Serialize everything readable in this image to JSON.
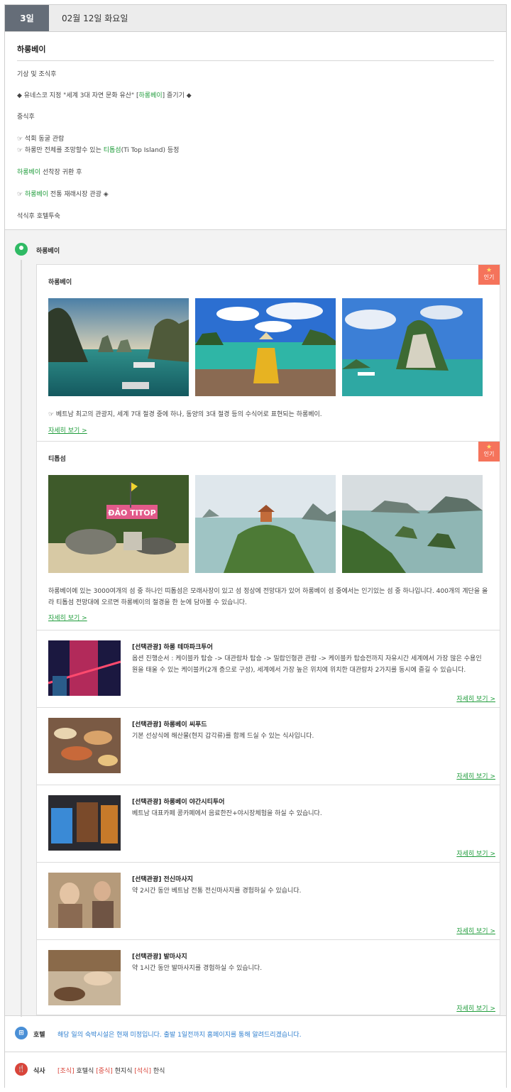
{
  "day": {
    "number": "3일",
    "date": "02월 12일 화요일"
  },
  "summary": {
    "title": "하롱베이",
    "lines": [
      {
        "parts": [
          "기상 및 조식후"
        ]
      },
      {
        "parts": [
          "◆ 유네스코 지정 \"세계 3대 자연 문화 유산\" [",
          "하롱베이",
          "] 즐기기 ◆"
        ]
      },
      {
        "parts": [
          "중식후"
        ]
      },
      {
        "parts": [
          "☞ 석회 동굴 관람"
        ]
      },
      {
        "parts": [
          "☞ 하롱만 전체를 조망할수 있는 ",
          "티톱섬",
          "(Ti Top Island) 등정"
        ]
      },
      {
        "parts": [
          "",
          "하롱베이",
          " 선착장 귀환 후"
        ]
      },
      {
        "parts": [
          "☞ ",
          "하롱베이",
          " 전통 재래시장 관광 ◈"
        ]
      },
      {
        "parts": [
          "석식후 호텔투숙"
        ]
      }
    ]
  },
  "location": {
    "label": "하롱베이"
  },
  "spots": [
    {
      "title": "하롱베이",
      "badge": "인기",
      "desc": "☞ 베트남 최고의 관광지, 세계 7대 절경 중에 하나, 동양의 3대 절경 등의 수식어로 표현되는 하롱베이.",
      "more": "자세히 보기 >"
    },
    {
      "title": "티톱섬",
      "badge": "인기",
      "desc": "하롱베이에 있는 3000여개의 섬 중 하나인 띠톱섬은 모래사장이 있고 섬 정상에 전망대가 있어 하롱베이 섬 중에서는 인기있는 섬 중 하나입니다. 400개의 계단을 올라 티톱섬 전망대에 오르면 하롱베이의 절경을 한 눈에 담아볼 수 있습니다.",
      "more": "자세히 보기 >",
      "sign": "ĐẢO TITOP"
    }
  ],
  "options": [
    {
      "title": "[선택관광] 하롱 테마파크투어",
      "desc": "옵션 진행순서 : 케이블카 탑승 -> 대관람차 탑승 -> 밀랍인형관 관람 -> 케이블카 탑승전까지 자유시간 세계에서 가장 많은 수용인원을 태울 수 있는 케이블카(2개 층으로 구성), 세계에서 가장 높은 위치에 위치한 대관람차 2가지를 동시에 즐길 수 있습니다.",
      "more": "자세히 보기 >"
    },
    {
      "title": "[선택관광] 하롱베이 씨푸드",
      "desc": "기본 선상식에 해산물(현지 갑각류)를 함께 드실 수 있는 식사입니다.",
      "more": "자세히 보기 >"
    },
    {
      "title": "[선택관광] 하롱베이 야간시티투어",
      "desc": "베트남 대표카페 콩카페에서 음료한잔+야시장체험을 하실 수 있습니다.",
      "more": "자세히 보기 >"
    },
    {
      "title": "[선택관광] 전신마사지",
      "desc": "약 2시간 동안 베트남 전통 전신마사지를 경험하실 수 있습니다.",
      "more": "자세히 보기 >"
    },
    {
      "title": "[선택관광] 발마사지",
      "desc": "약 1시간 동안 발마사지를 경험하실 수 있습니다.",
      "more": "자세히 보기 >"
    }
  ],
  "hotel": {
    "label": "호텔",
    "icon": "hotel-icon",
    "text": "해당 일의 숙박시설은 현재 미정입니다. 출발 1일전까지 홈페이지를 통해 알려드리겠습니다."
  },
  "meal": {
    "label": "식사",
    "icon": "fork-knife-icon",
    "breakfast_tag": "[조식]",
    "breakfast": "호텔식",
    "lunch_tag": "[중식]",
    "lunch": "현지식",
    "dinner_tag": "[석식]",
    "dinner": "한식"
  },
  "colors": {
    "day_badge": "#656d78",
    "accent_green": "#1f9c3b",
    "badge_red": "#f5735b",
    "hotel_blue": "#2f7fcf",
    "meal_red": "#d9453b",
    "pin_green": "#2fba64"
  }
}
